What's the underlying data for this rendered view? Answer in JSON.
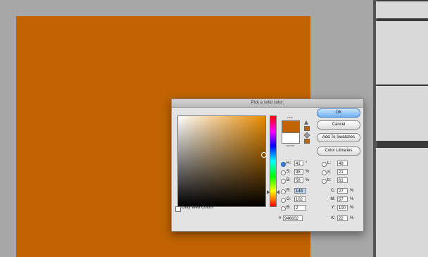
{
  "dialog": {
    "title": "Pick a solid color:",
    "new_label": "new",
    "current_label": "current",
    "buttons": {
      "ok": "OK",
      "cancel": "Cancel",
      "add_to_swatches": "Add To Swatches",
      "color_libraries": "Color Libraries"
    },
    "only_web_colors": "Only Web Colors",
    "hsb": [
      {
        "label": "H:",
        "value": "41",
        "unit": "°",
        "selected": true
      },
      {
        "label": "S:",
        "value": "98",
        "unit": "%",
        "selected": false
      },
      {
        "label": "B:",
        "value": "58",
        "unit": "%",
        "selected": false
      }
    ],
    "rgb": [
      {
        "label": "R:",
        "value": "148",
        "selected": false
      },
      {
        "label": "G:",
        "value": "102",
        "selected": false
      },
      {
        "label": "B:",
        "value": "2",
        "selected": false
      }
    ],
    "lab": [
      {
        "label": "L:",
        "value": "49"
      },
      {
        "label": "a:",
        "value": "21"
      },
      {
        "label": "b:",
        "value": "61"
      }
    ],
    "cmyk": [
      {
        "label": "C:",
        "value": "27",
        "unit": "%"
      },
      {
        "label": "M:",
        "value": "57",
        "unit": "%"
      },
      {
        "label": "Y:",
        "value": "100",
        "unit": "%"
      },
      {
        "label": "K:",
        "value": "22",
        "unit": "%"
      }
    ],
    "hex_label": "#",
    "hex_value": "946602"
  },
  "colors": {
    "canvas": "#c06300",
    "accent": "#3b7fd6"
  }
}
